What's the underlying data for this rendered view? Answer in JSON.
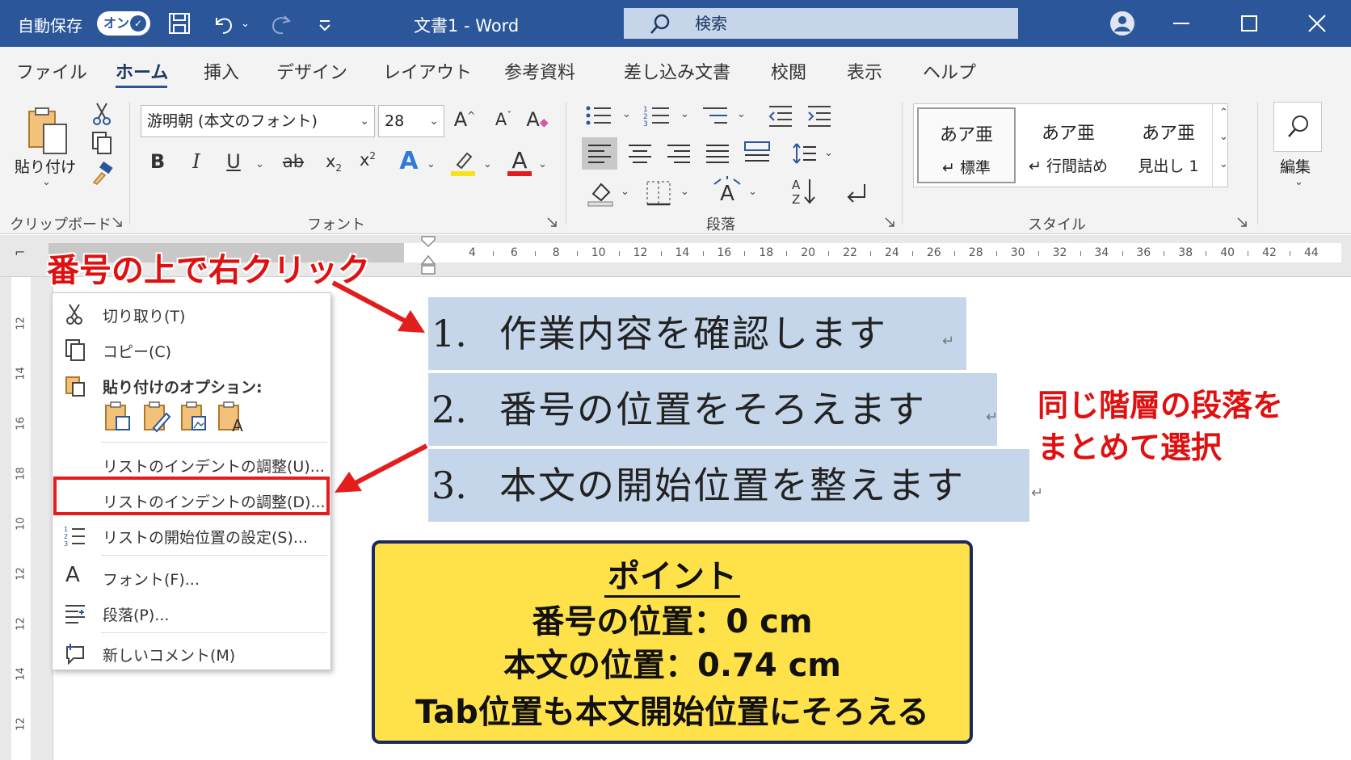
{
  "titlebar": {
    "autosave": "自動保存",
    "toggle": "オン",
    "title": "文書1  -  Word",
    "search": "検索"
  },
  "tabs": [
    "ファイル",
    "ホーム",
    "挿入",
    "デザイン",
    "レイアウト",
    "参考資料",
    "差し込み文書",
    "校閲",
    "表示",
    "ヘルプ"
  ],
  "ribbon": {
    "paste_label": "貼り付け",
    "font_name": "游明朝 (本文のフォント)",
    "font_size": "28",
    "edit_label": "編集",
    "groups": {
      "clipboard": "クリップボード",
      "font": "フォント",
      "paragraph": "段落",
      "styles": "スタイル"
    },
    "styles": [
      {
        "preview": "あア亜",
        "name": "↵ 標準"
      },
      {
        "preview": "あア亜",
        "name": "↵ 行間詰め"
      },
      {
        "preview": "あア亜",
        "name": "見出し 1"
      }
    ]
  },
  "ruler": {
    "numbers": [
      "4",
      "6",
      "8",
      "10",
      "12",
      "14",
      "16",
      "18",
      "20",
      "22",
      "24",
      "26",
      "28",
      "30",
      "32",
      "34",
      "36",
      "38",
      "40",
      "42",
      "44"
    ],
    "vertical_numbers": [
      "12",
      "14",
      "16",
      "18",
      "10",
      "12",
      "12",
      "14",
      "12"
    ]
  },
  "document": {
    "lines": [
      {
        "num": "1.",
        "text": "作業内容を確認します"
      },
      {
        "num": "2.",
        "text": "番号の位置をそろえます"
      },
      {
        "num": "3.",
        "text": "本文の開始位置を整えます"
      }
    ],
    "pilcrow": "↵"
  },
  "context_menu": {
    "cut": "切り取り(T)",
    "copy": "コピー(C)",
    "paste_options": "貼り付けのオプション:",
    "indent1": "リストのインデントの調整(U)...",
    "indent2": "リストのインデントの調整(D)...",
    "start": "リストの開始位置の設定(S)...",
    "font": "フォント(F)...",
    "paragraph": "段落(P)...",
    "comment": "新しいコメント(M)"
  },
  "annotations": {
    "right_click": "番号の上で右クリック",
    "select_line1": "同じ階層の段落を",
    "select_line2": "まとめて選択",
    "point_title": "ポイント",
    "point_line1": "番号の位置：0 cm",
    "point_line2": "本文の位置：0.74 cm",
    "point_line3": "Tab位置も本文開始位置にそろえる"
  },
  "colors": {
    "word_blue": "#2b579a",
    "selection": "#c5d6ea",
    "annotation_red": "#e01010",
    "point_yellow": "#ffe14a"
  }
}
